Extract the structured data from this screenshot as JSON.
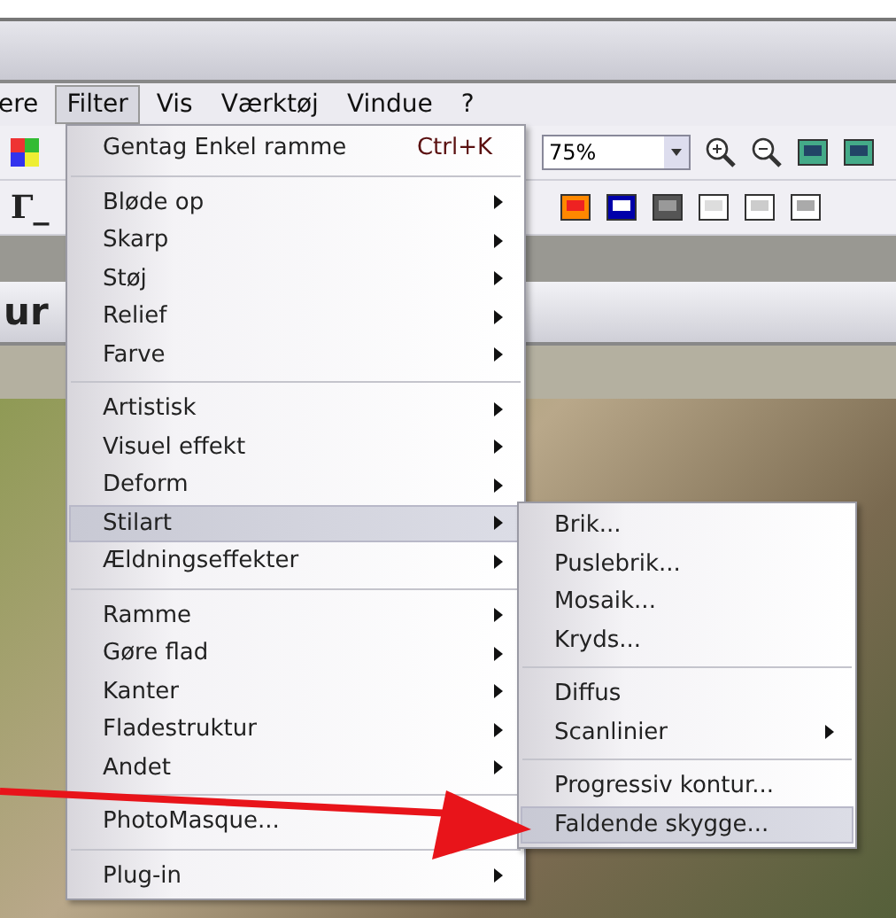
{
  "menubar": [
    {
      "label": "ere",
      "selected": false
    },
    {
      "label": "Filter",
      "selected": true
    },
    {
      "label": "Vis",
      "selected": false
    },
    {
      "label": "Værktøj",
      "selected": false
    },
    {
      "label": "Vindue",
      "selected": false
    },
    {
      "label": "?",
      "selected": false
    }
  ],
  "toolbar": {
    "zoom": "75%"
  },
  "toolbar2": {
    "tool_glyph": "Γ_"
  },
  "document": {
    "title": "ur"
  },
  "filter_menu": [
    [
      {
        "label": "Gentag Enkel ramme",
        "shortcut": "Ctrl+K",
        "submenu": false,
        "selected": false
      }
    ],
    [
      {
        "label": "Bløde op",
        "submenu": true,
        "selected": false
      },
      {
        "label": "Skarp",
        "submenu": true,
        "selected": false
      },
      {
        "label": "Støj",
        "submenu": true,
        "selected": false
      },
      {
        "label": "Relief",
        "submenu": true,
        "selected": false
      },
      {
        "label": "Farve",
        "submenu": true,
        "selected": false
      }
    ],
    [
      {
        "label": "Artistisk",
        "submenu": true,
        "selected": false
      },
      {
        "label": "Visuel effekt",
        "submenu": true,
        "selected": false
      },
      {
        "label": "Deform",
        "submenu": true,
        "selected": false
      },
      {
        "label": "Stilart",
        "submenu": true,
        "selected": true
      },
      {
        "label": "Ældningseffekter",
        "submenu": true,
        "selected": false
      }
    ],
    [
      {
        "label": "Ramme",
        "submenu": true,
        "selected": false
      },
      {
        "label": "Gøre flad",
        "submenu": true,
        "selected": false
      },
      {
        "label": "Kanter",
        "submenu": true,
        "selected": false
      },
      {
        "label": "Fladestruktur",
        "submenu": true,
        "selected": false
      },
      {
        "label": "Andet",
        "submenu": true,
        "selected": false
      }
    ],
    [
      {
        "label": "PhotoMasque...",
        "submenu": false,
        "selected": false
      }
    ],
    [
      {
        "label": "Plug-in",
        "submenu": true,
        "selected": false
      }
    ]
  ],
  "stilart_menu": [
    [
      {
        "label": "Brik...",
        "submenu": false,
        "selected": false
      },
      {
        "label": "Puslebrik...",
        "submenu": false,
        "selected": false
      },
      {
        "label": "Mosaik...",
        "submenu": false,
        "selected": false
      },
      {
        "label": "Kryds...",
        "submenu": false,
        "selected": false
      }
    ],
    [
      {
        "label": "Diffus",
        "submenu": false,
        "selected": false
      },
      {
        "label": "Scanlinier",
        "submenu": true,
        "selected": false
      }
    ],
    [
      {
        "label": "Progressiv kontur...",
        "submenu": false,
        "selected": false
      },
      {
        "label": "Faldende skygge...",
        "submenu": false,
        "selected": true
      }
    ]
  ]
}
